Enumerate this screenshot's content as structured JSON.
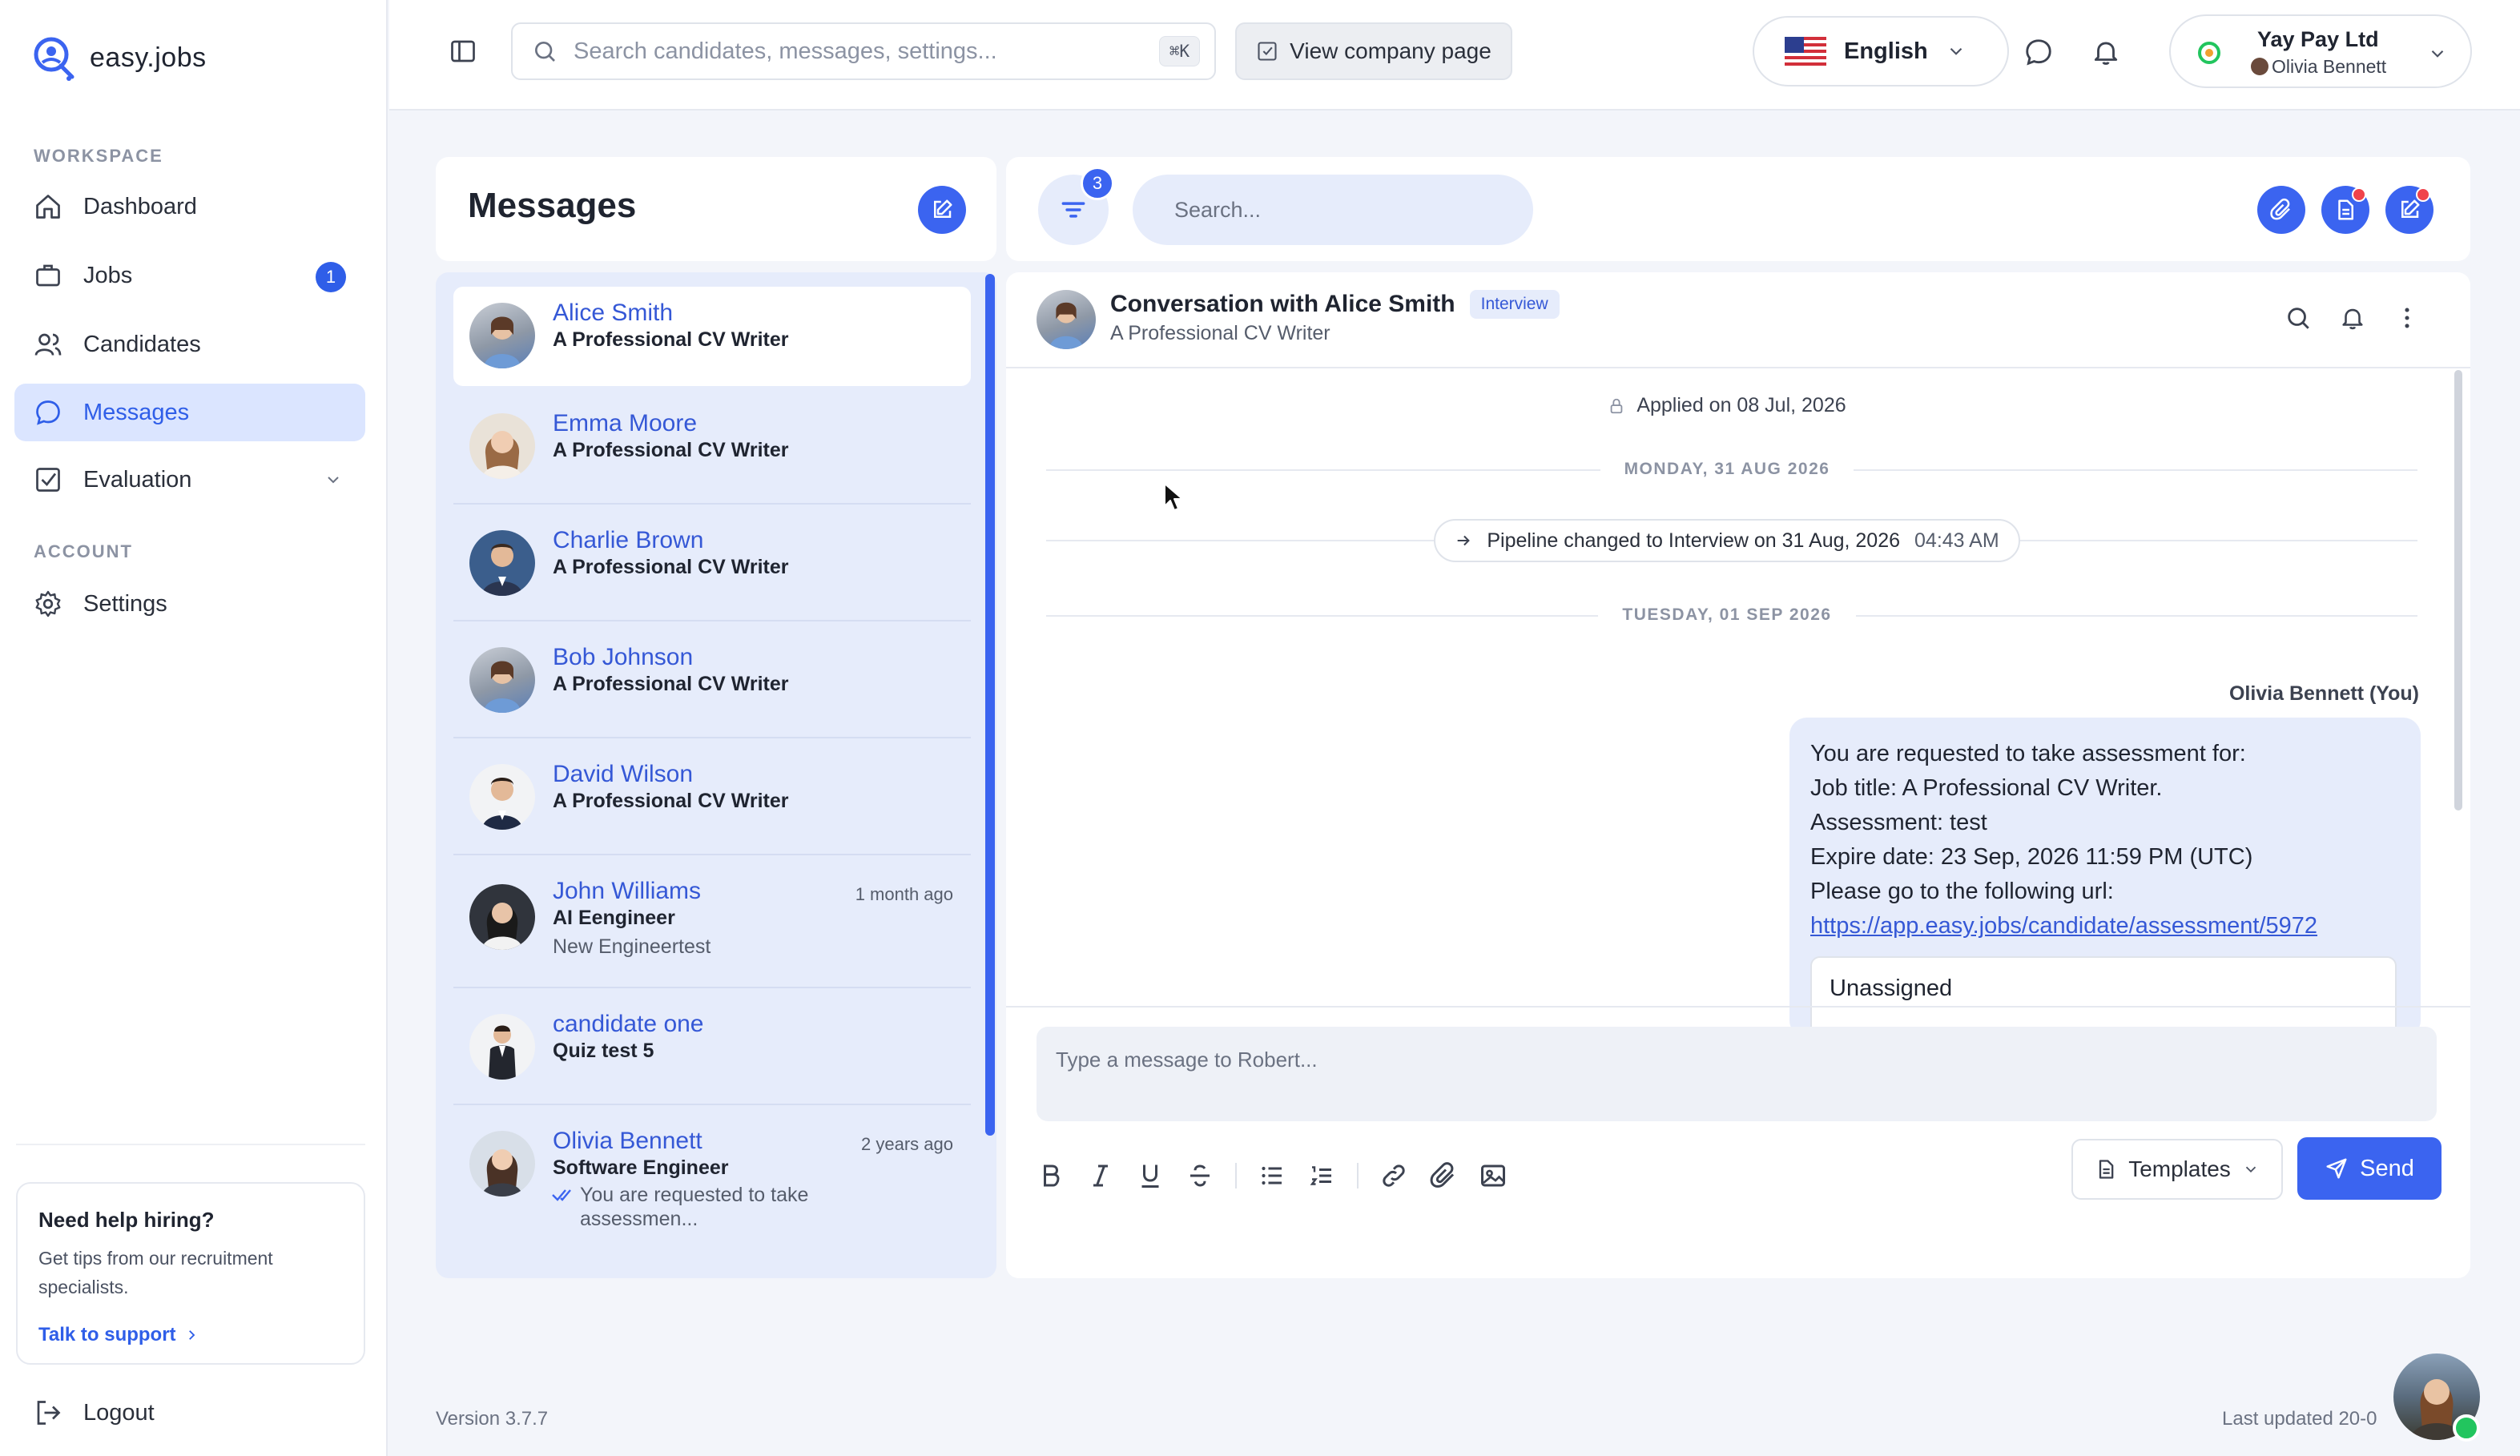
{
  "app": {
    "name": "easy.jobs",
    "version": "Version 3.7.7",
    "last_updated": "Last updated 20-0"
  },
  "sidebar": {
    "workspace_label": "WORKSPACE",
    "account_label": "ACCOUNT",
    "items": [
      {
        "label": "Dashboard",
        "icon": "home-icon"
      },
      {
        "label": "Jobs",
        "icon": "briefcase-icon",
        "badge": "1"
      },
      {
        "label": "Candidates",
        "icon": "users-icon"
      },
      {
        "label": "Messages",
        "icon": "chat-icon",
        "active": true
      },
      {
        "label": "Evaluation",
        "icon": "checklist-icon"
      }
    ],
    "settings": {
      "label": "Settings",
      "icon": "gear-icon"
    },
    "help": {
      "title": "Need help hiring?",
      "text": "Get tips from our recruitment specialists.",
      "link": "Talk to support"
    },
    "logout": "Logout"
  },
  "topbar": {
    "search_placeholder": "Search candidates, messages, settings...",
    "shortcut": "⌘K",
    "company_page": "View company page",
    "language": "English",
    "company": "Yay Pay Ltd",
    "user": "Olivia Bennett"
  },
  "messages_panel": {
    "title": "Messages",
    "filter_count": "3",
    "search_placeholder": "Search...",
    "conversations": [
      {
        "name": "Alice Smith",
        "job": "A Professional CV Writer",
        "selected": true
      },
      {
        "name": "Emma Moore",
        "job": "A Professional CV Writer"
      },
      {
        "name": "Charlie Brown",
        "job": "A Professional CV Writer"
      },
      {
        "name": "Bob Johnson",
        "job": "A Professional CV Writer"
      },
      {
        "name": "David Wilson",
        "job": "A Professional CV Writer"
      },
      {
        "name": "John Williams",
        "job": "AI Eengineer",
        "preview": "New Engineertest",
        "time": "1 month ago"
      },
      {
        "name": "candidate one",
        "job": "Quiz test 5"
      },
      {
        "name": "Olivia Bennett",
        "job": "Software Engineer",
        "preview_line1": "You are requested to take",
        "preview_line2": "assessmen...",
        "time": "2 years ago"
      }
    ]
  },
  "conversation": {
    "title": "Conversation with Alice Smith",
    "tag": "Interview",
    "subtitle": "A Professional CV Writer",
    "applied": "Applied on 08 Jul, 2026",
    "date1": "MONDAY, 31 AUG 2026",
    "pipeline_text": "Pipeline changed to Interview on 31 Aug, 2026",
    "pipeline_time": "04:43 AM",
    "date2": "TUESDAY, 01 SEP 2026",
    "sender": "Olivia Bennett (You)",
    "message_lines": [
      "You are requested to take assessment for:",
      "Job title: A Professional CV Writer.",
      "Assessment: test",
      "Expire date: 23 Sep, 2026 11:59 PM (UTC)",
      "Please go to the following url:"
    ],
    "message_link": "https://app.easy.jobs/candidate/assessment/5972",
    "card_text": "Unassigned",
    "composer_placeholder": "Type a message to Robert...",
    "templates": "Templates",
    "send": "Send"
  },
  "colors": {
    "accent": "#3b64f0",
    "active_bg": "#dbe5ff",
    "list_bg": "#e6ecfb",
    "alert": "#f0434b",
    "online": "#22c55e"
  }
}
